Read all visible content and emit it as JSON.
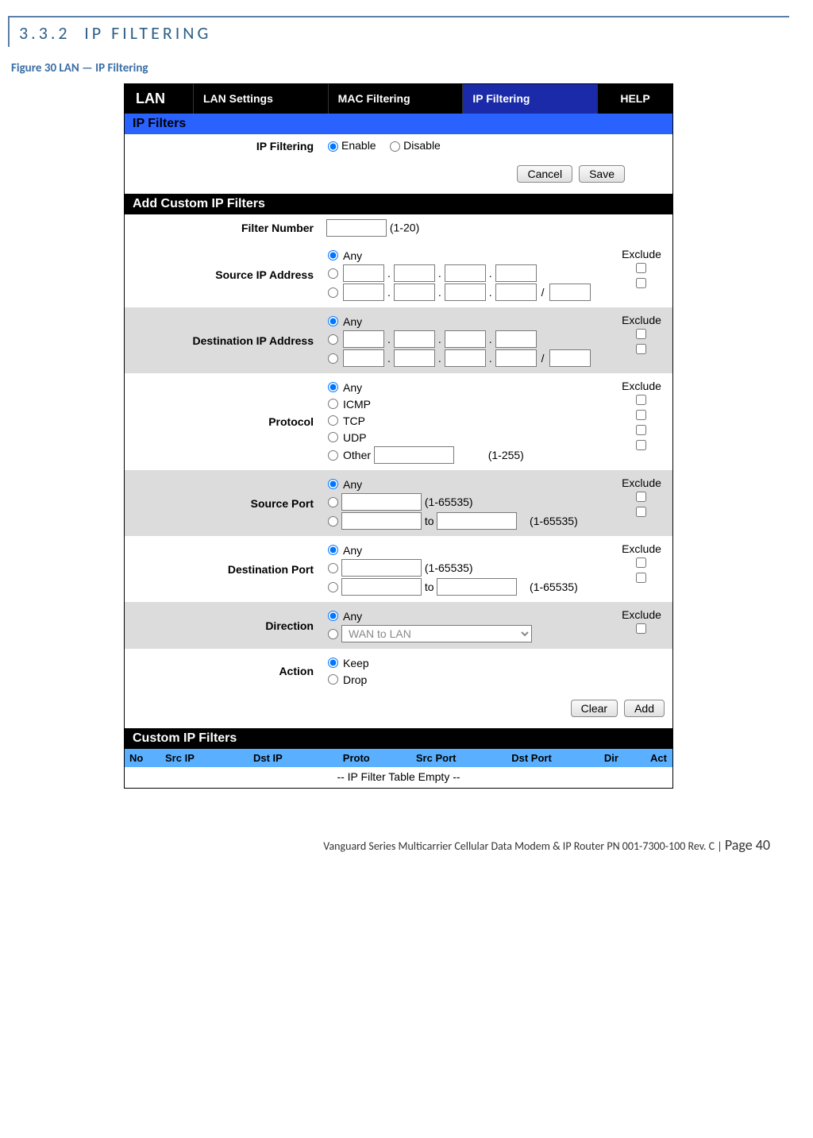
{
  "heading": {
    "number": "3.3.2",
    "title": "IP FILTERING"
  },
  "figure_caption": "Figure 30 LAN — IP Filtering",
  "tabs": {
    "lan": "LAN",
    "items": [
      "LAN Settings",
      "MAC Filtering",
      "IP Filtering"
    ],
    "help": "HELP"
  },
  "ipfilters": {
    "header": "IP Filters",
    "label": "IP Filtering",
    "enable": "Enable",
    "disable": "Disable",
    "cancel": "Cancel",
    "save": "Save"
  },
  "add": {
    "header": "Add Custom IP Filters",
    "filter_number_label": "Filter Number",
    "filter_number_hint": "(1-20)",
    "src_ip_label": "Source IP Address",
    "dst_ip_label": "Destination IP Address",
    "protocol_label": "Protocol",
    "protocol": {
      "any": "Any",
      "icmp": "ICMP",
      "tcp": "TCP",
      "udp": "UDP",
      "other": "Other",
      "other_hint": "(1-255)"
    },
    "src_port_label": "Source Port",
    "dst_port_label": "Destination Port",
    "port_hint": "(1-65535)",
    "port_range_hint": "(1-65535)",
    "to": "to",
    "any": "Any",
    "direction_label": "Direction",
    "direction_option": "WAN to LAN",
    "action_label": "Action",
    "action": {
      "keep": "Keep",
      "drop": "Drop"
    },
    "exclude": "Exclude",
    "clear": "Clear",
    "add_btn": "Add",
    "slash": "/"
  },
  "custom": {
    "header": "Custom IP Filters",
    "cols": {
      "no": "No",
      "src": "Src IP",
      "dst": "Dst IP",
      "proto": "Proto",
      "sport": "Src Port",
      "dport": "Dst Port",
      "dir": "Dir",
      "act": "Act"
    },
    "empty": "-- IP Filter Table Empty --"
  },
  "footer": {
    "text": "Vanguard Series Multicarrier Cellular Data Modem & IP Router PN 001-7300-100 Rev. C",
    "page_label": "Page 40"
  }
}
